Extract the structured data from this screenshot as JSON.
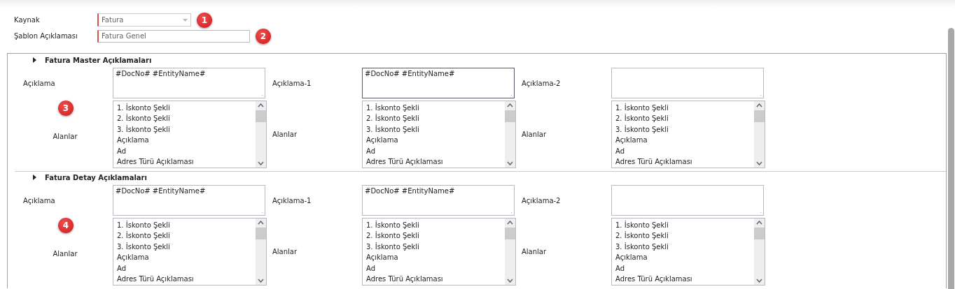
{
  "source": {
    "label": "Kaynak",
    "value": "Fatura",
    "badge": "1"
  },
  "template": {
    "label": "Şablon Açıklaması",
    "value": "Fatura Genel",
    "badge": "2"
  },
  "sections": [
    {
      "title": "Fatura Master Açıklamaları",
      "badge": "3",
      "columns": [
        {
          "label": "Açıklama",
          "value": "#DocNo# #EntityName#",
          "focused": false,
          "fields_label": "Alanlar",
          "fields": [
            "1. İskonto Şekli",
            "2. İskonto Şekli",
            "3. İskonto Şekli",
            "Açıklama",
            "Ad",
            "Adres Türü Açıklaması"
          ]
        },
        {
          "label": "Açıklama-1",
          "value": "#DocNo# #EntityName#",
          "focused": true,
          "fields_label": "Alanlar",
          "fields": [
            "1. İskonto Şekli",
            "2. İskonto Şekli",
            "3. İskonto Şekli",
            "Açıklama",
            "Ad",
            "Adres Türü Açıklaması"
          ]
        },
        {
          "label": "Açıklama-2",
          "focused": false,
          "fields_label": "Alanlar",
          "fields": [
            "1. İskonto Şekli",
            "2. İskonto Şekli",
            "3. İskonto Şekli",
            "Açıklama",
            "Ad",
            "Adres Türü Açıklaması"
          ]
        }
      ]
    },
    {
      "title": "Fatura Detay Açıklamaları",
      "badge": "4",
      "columns": [
        {
          "label": "Açıklama",
          "value": "#DocNo# #EntityName#",
          "focused": false,
          "fields_label": "Alanlar",
          "fields": [
            "1. İskonto Şekli",
            "2. İskonto Şekli",
            "3. İskonto Şekli",
            "Açıklama",
            "Ad",
            "Adres Türü Açıklaması"
          ]
        },
        {
          "label": "Açıklama-1",
          "value": "#DocNo# #EntityName#",
          "focused": false,
          "fields_label": "Alanlar",
          "fields": [
            "1. İskonto Şekli",
            "2. İskonto Şekli",
            "3. İskonto Şekli",
            "Açıklama",
            "Ad",
            "Adres Türü Açıklaması"
          ]
        },
        {
          "label": "Açıklama-2",
          "focused": false,
          "fields_label": "Alanlar",
          "fields": [
            "1. İskonto Şekli",
            "2. İskonto Şekli",
            "3. İskonto Şekli",
            "Açıklama",
            "Ad",
            "Adres Türü Açıklaması"
          ]
        }
      ]
    }
  ]
}
